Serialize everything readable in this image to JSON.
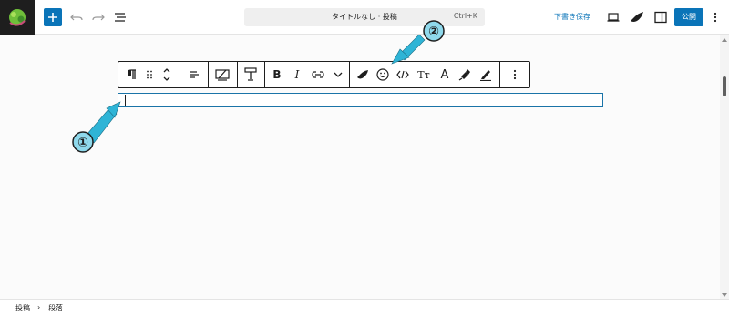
{
  "header": {
    "command_title": "タイトルなし · 投稿",
    "shortcut": "Ctrl+K",
    "save_draft_label": "下書き保存",
    "publish_label": "公開"
  },
  "toolbar": {
    "buttons": [
      {
        "name": "paragraph-icon",
        "glyph": "¶"
      },
      {
        "name": "drag-handle-icon",
        "glyph": "⠿"
      },
      {
        "name": "move-up-down-icon"
      },
      {
        "name": "align-icon"
      },
      {
        "name": "format-icon"
      },
      {
        "name": "text-style-icon"
      },
      {
        "name": "bold-button",
        "glyph": "B"
      },
      {
        "name": "italic-button",
        "glyph": "I"
      },
      {
        "name": "link-icon"
      },
      {
        "name": "chevron-down-icon"
      },
      {
        "name": "extension-icon"
      },
      {
        "name": "emoji-icon"
      },
      {
        "name": "code-icon"
      },
      {
        "name": "text-size-icon",
        "glyph": "Tт"
      },
      {
        "name": "font-icon",
        "glyph": "A"
      },
      {
        "name": "highlighter-icon"
      },
      {
        "name": "pen-icon"
      },
      {
        "name": "more-options-icon"
      }
    ]
  },
  "annotations": {
    "marker_1": "①",
    "marker_2": "②",
    "arrow_color": "#2fb4d6"
  },
  "breadcrumb": {
    "item_1": "投稿",
    "separator": "›",
    "item_2": "段落"
  },
  "colors": {
    "accent": "#0a74b8",
    "block_border": "#1a74a8"
  }
}
